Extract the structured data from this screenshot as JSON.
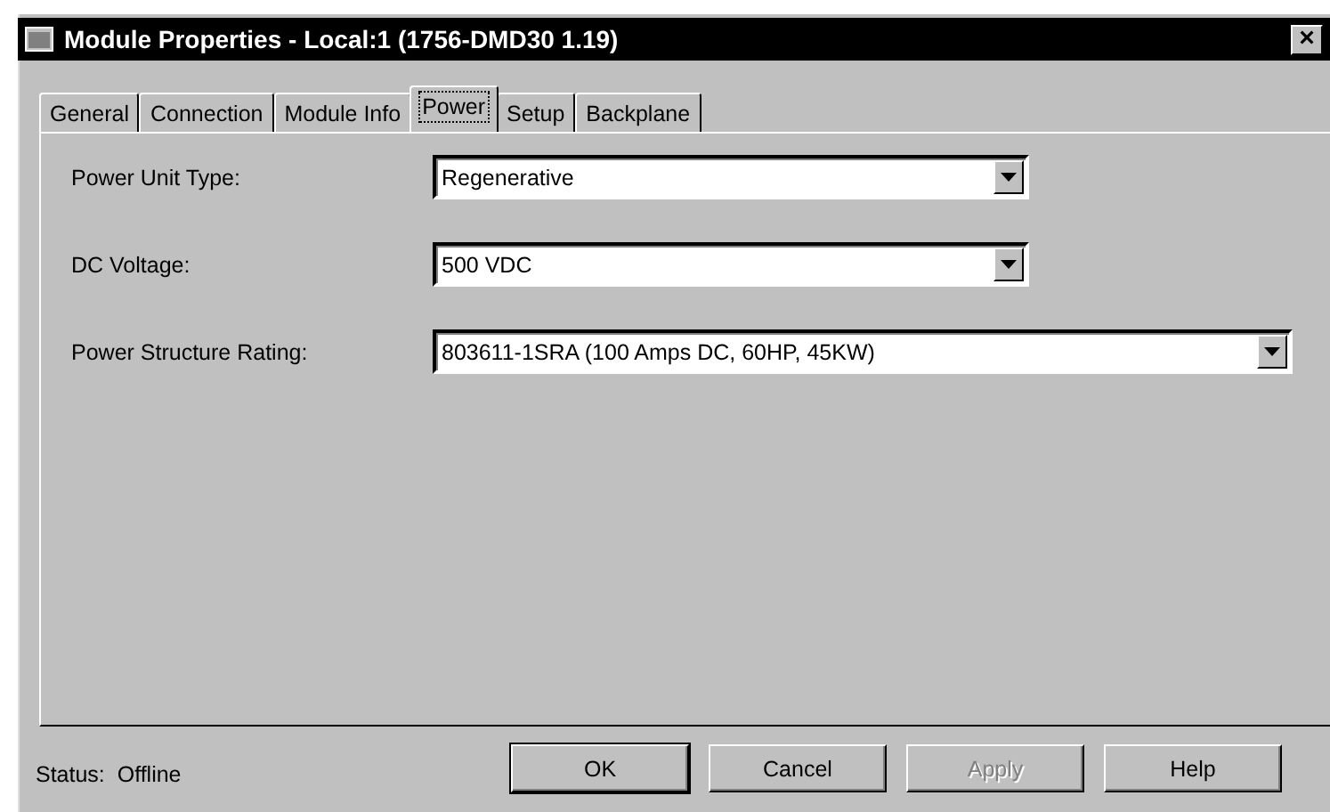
{
  "window": {
    "title": "Module Properties - Local:1 (1756-DMD30 1.19)",
    "close": "×"
  },
  "tabs": [
    {
      "label": "General",
      "selected": false
    },
    {
      "label": "Connection",
      "selected": false
    },
    {
      "label": "Module Info",
      "selected": false
    },
    {
      "label": "Power",
      "selected": true
    },
    {
      "label": "Setup",
      "selected": false
    },
    {
      "label": "Backplane",
      "selected": false
    }
  ],
  "fields": [
    {
      "label": "Power Unit Type:",
      "value": "Regenerative",
      "wide": false
    },
    {
      "label": "DC Voltage:",
      "value": "500 VDC",
      "wide": false
    },
    {
      "label": "Power Structure Rating:",
      "value": "803611-1SRA (100 Amps DC, 60HP, 45KW)",
      "wide": true
    }
  ],
  "status_bar": {
    "label": "Status:",
    "value": "Offline"
  },
  "buttons": [
    {
      "label": "OK",
      "disabled": false,
      "default": true
    },
    {
      "label": "Cancel",
      "disabled": false,
      "default": false
    },
    {
      "label": "Apply",
      "disabled": true,
      "default": false
    },
    {
      "label": "Help",
      "disabled": false,
      "default": false
    }
  ]
}
